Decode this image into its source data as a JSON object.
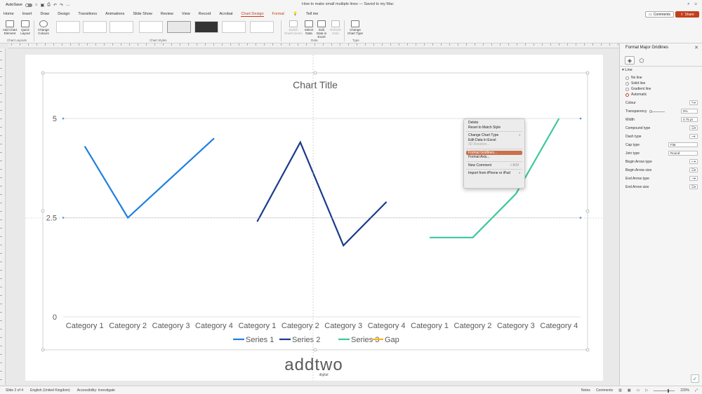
{
  "titlebar": {
    "autosave_label": "AutoSave",
    "doc_title": "How to make small multiple lines — Saved to my Mac",
    "right_icons": [
      "search-icon",
      "share-people-icon"
    ]
  },
  "tabs": [
    "Home",
    "Insert",
    "Draw",
    "Design",
    "Transitions",
    "Animations",
    "Slide Show",
    "Review",
    "View",
    "Record",
    "Acrobat",
    "Chart Design",
    "Format",
    "Tell me"
  ],
  "active_tab": "Chart Design",
  "comments_label": "Comments",
  "share_label": "Share",
  "ribbon": {
    "add_chart_element": "Add Chart Element",
    "quick_layout": "Quick Layout",
    "change_colours": "Change Colours",
    "switch_row_column": "Switch Row/Column",
    "select_data": "Select Data",
    "edit_data_in_excel": "Edit Data in Excel",
    "refresh_data": "Refresh Data",
    "change_chart_type": "Change Chart Type",
    "groups": {
      "chart_layouts": "Chart Layouts",
      "chart_styles": "Chart Styles",
      "data": "Data",
      "type": "Type"
    }
  },
  "context_menu": {
    "items": [
      {
        "label": "Delete",
        "enabled": true
      },
      {
        "label": "Reset to Match Style",
        "enabled": true
      },
      {
        "sep": true
      },
      {
        "label": "Change Chart Type",
        "enabled": true,
        "submenu": true
      },
      {
        "label": "Edit Data in Excel",
        "enabled": true
      },
      {
        "label": "3D Rotation...",
        "enabled": false
      },
      {
        "sep": true
      },
      {
        "label": "Format Gridlines...",
        "enabled": true,
        "highlighted": true
      },
      {
        "label": "Format Axis...",
        "enabled": true
      },
      {
        "sep": true
      },
      {
        "label": "New Comment",
        "enabled": true,
        "shortcut": "⇧⌘M"
      },
      {
        "sep": true
      },
      {
        "label": "Import from iPhone or iPad",
        "enabled": true,
        "submenu": true
      }
    ]
  },
  "format_pane": {
    "title": "Format Major Gridlines",
    "section": "Line",
    "line_options": [
      "No line",
      "Solid line",
      "Gradient line",
      "Automatic"
    ],
    "selected_option": "Automatic",
    "colour_label": "Colour",
    "transparency_label": "Transparency",
    "transparency_value": "0%",
    "width_label": "Width",
    "width_value": "0.75 pt",
    "compound_type_label": "Compound type",
    "dash_type_label": "Dash type",
    "cap_type_label": "Cap type",
    "cap_type_value": "Flat",
    "join_type_label": "Join type",
    "join_type_value": "Round",
    "begin_arrow_type_label": "Begin Arrow type",
    "begin_arrow_size_label": "Begin Arrow size",
    "end_arrow_type_label": "End Arrow type",
    "end_arrow_size_label": "End Arrow size"
  },
  "statusbar": {
    "slide_info": "Slide 2 of 4",
    "language": "English (United Kingdom)",
    "accessibility": "Accessibility: Investigate",
    "notes": "Notes",
    "comments": "Comments",
    "zoom": "220%"
  },
  "chart_data": {
    "type": "line",
    "title": "Chart Title",
    "y_ticks": [
      "0",
      "2.5",
      "5"
    ],
    "ylim": [
      0,
      5
    ],
    "categories": [
      "Category 1",
      "Category 2",
      "Category 3",
      "Category 4"
    ],
    "panels": 3,
    "series": [
      {
        "name": "Series 1",
        "color": "#1f7fe0",
        "panel": 0,
        "values": [
          4.3,
          2.5,
          3.5,
          4.5
        ]
      },
      {
        "name": "Series 2",
        "color": "#1a3a8c",
        "panel": 1,
        "values": [
          2.4,
          4.4,
          1.8,
          2.9
        ]
      },
      {
        "name": "Series 3",
        "color": "#3cc79e",
        "panel": 2,
        "values": [
          2.0,
          2.0,
          3.1,
          5.0
        ]
      },
      {
        "name": "Gap",
        "color": "#f2b21b",
        "panel": null,
        "values": []
      }
    ],
    "grid": true,
    "legend": "bottom",
    "watermark": "addtwo digital"
  }
}
